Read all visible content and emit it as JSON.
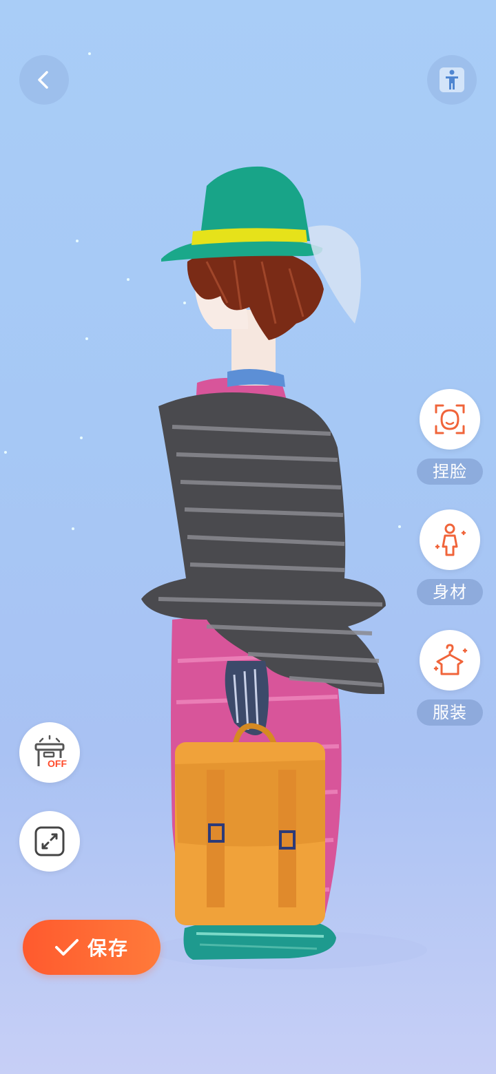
{
  "top_bar": {
    "back_icon": "chevron-left-icon",
    "pose_icon": "standing-figure-icon"
  },
  "side_menu": {
    "items": [
      {
        "label": "捏脸",
        "icon": "face-sculpt-icon"
      },
      {
        "label": "身材",
        "icon": "body-shape-icon"
      },
      {
        "label": "服装",
        "icon": "clothing-icon"
      }
    ]
  },
  "left_tools": {
    "background_toggle": {
      "icon": "background-off-icon",
      "badge": "OFF"
    },
    "fullscreen": {
      "icon": "expand-icon"
    }
  },
  "save_button": {
    "label": "保存",
    "icon": "check-icon"
  },
  "colors": {
    "accent": "#ff5a2e",
    "icon_orange": "#f0643a",
    "sky_top": "#a9cdf7",
    "sky_bottom": "#c7cff6"
  }
}
